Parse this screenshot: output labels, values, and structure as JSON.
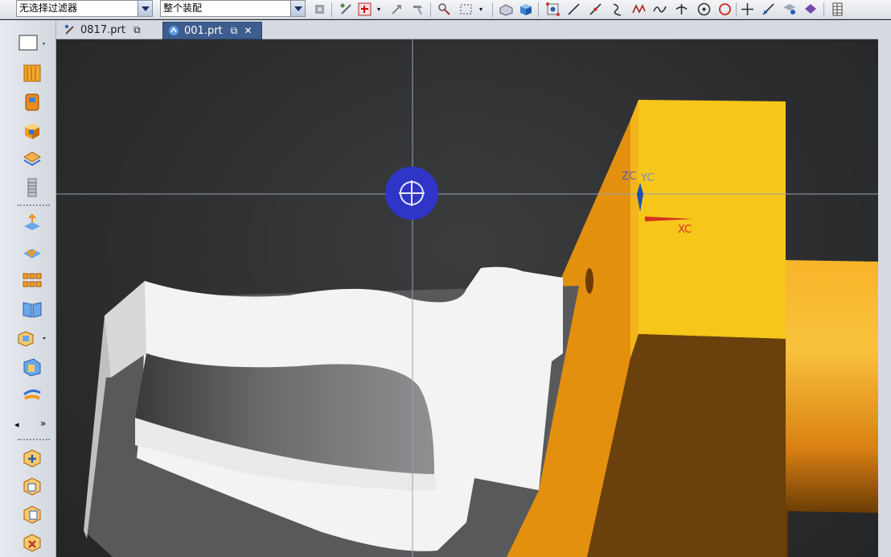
{
  "toolbar": {
    "selection_filter": "无选择过滤器",
    "scope": "整个装配"
  },
  "tabs": [
    {
      "label": "0817.prt",
      "active": false
    },
    {
      "label": "001.prt",
      "active": true
    }
  ],
  "viewport": {
    "wcs_labels": {
      "zc": "ZC",
      "yc": "YC",
      "xc": "XC"
    }
  },
  "colors": {
    "accent_tab": "#3c5d8d",
    "part_yellow": "#f6c61a",
    "part_orange": "#e3900f",
    "snap_point": "#2f35c7"
  },
  "icons": {
    "left_bar": [
      "select-box-icon",
      "book-icon",
      "part-navigator-icon",
      "cube-icon",
      "layers-icon",
      "spring-icon",
      "extrude-icon",
      "array-icon",
      "pattern-icon",
      "open-book-icon",
      "block-icon",
      "view-icon",
      "material-icon",
      "assembly-add-icon",
      "assembly-constraint-icon",
      "assembly-move-icon",
      "assembly-delete-icon"
    ]
  }
}
